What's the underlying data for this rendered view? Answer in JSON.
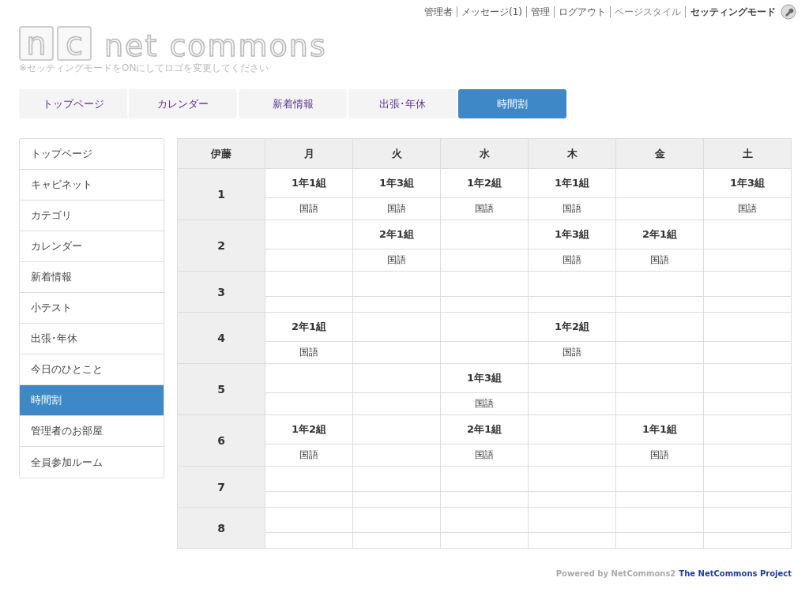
{
  "header_links": [
    "管理者",
    "メッセージ(1)",
    "管理",
    "ログアウト",
    "ページスタイル"
  ],
  "setting_mode": "セッティングモード",
  "logo": {
    "letters": [
      "n",
      "c"
    ],
    "text": "net commons",
    "note": "※セッティングモードをONにしてロゴを変更してください"
  },
  "tabs": [
    {
      "label": "トップページ",
      "selected": false
    },
    {
      "label": "カレンダー",
      "selected": false
    },
    {
      "label": "新着情報",
      "selected": false
    },
    {
      "label": "出張･年休",
      "selected": false
    },
    {
      "label": "時間割",
      "selected": true
    }
  ],
  "sidebar": {
    "items": [
      {
        "label": "トップページ",
        "selected": false
      },
      {
        "label": "キャビネット",
        "selected": false
      },
      {
        "label": "カテゴリ",
        "selected": false
      },
      {
        "label": "カレンダー",
        "selected": false
      },
      {
        "label": "新着情報",
        "selected": false
      },
      {
        "label": "小テスト",
        "selected": false
      },
      {
        "label": "出張･年休",
        "selected": false
      },
      {
        "label": "今日のひとこと",
        "selected": false
      },
      {
        "label": "時間割",
        "selected": true
      },
      {
        "label": "管理者のお部屋",
        "selected": false
      },
      {
        "label": "全員参加ルーム",
        "selected": false
      }
    ]
  },
  "timetable": {
    "corner": "伊藤",
    "columns": [
      "月",
      "火",
      "水",
      "木",
      "金",
      "土"
    ],
    "rows": [
      {
        "period": "1",
        "cells": [
          {
            "class": "1年1組",
            "subject": "国語"
          },
          {
            "class": "1年3組",
            "subject": "国語"
          },
          {
            "class": "1年2組",
            "subject": "国語"
          },
          {
            "class": "1年1組",
            "subject": "国語"
          },
          null,
          {
            "class": "1年3組",
            "subject": "国語"
          }
        ]
      },
      {
        "period": "2",
        "cells": [
          null,
          {
            "class": "2年1組",
            "subject": "国語"
          },
          null,
          {
            "class": "1年3組",
            "subject": "国語"
          },
          {
            "class": "2年1組",
            "subject": "国語"
          },
          null
        ]
      },
      {
        "period": "3",
        "cells": [
          null,
          null,
          null,
          null,
          null,
          null
        ]
      },
      {
        "period": "4",
        "cells": [
          {
            "class": "2年1組",
            "subject": "国語"
          },
          null,
          null,
          {
            "class": "1年2組",
            "subject": "国語"
          },
          null,
          null
        ]
      },
      {
        "period": "5",
        "cells": [
          null,
          null,
          {
            "class": "1年3組",
            "subject": "国語"
          },
          null,
          null,
          null
        ]
      },
      {
        "period": "6",
        "cells": [
          {
            "class": "1年2組",
            "subject": "国語"
          },
          null,
          {
            "class": "2年1組",
            "subject": "国語"
          },
          null,
          {
            "class": "1年1組",
            "subject": "国語"
          },
          null
        ]
      },
      {
        "period": "7",
        "cells": [
          null,
          null,
          null,
          null,
          null,
          null
        ]
      },
      {
        "period": "8",
        "cells": [
          null,
          null,
          null,
          null,
          null,
          null
        ]
      }
    ]
  },
  "footer": {
    "powered": "Powered by NetCommons2",
    "project": "The NetCommons Project"
  }
}
